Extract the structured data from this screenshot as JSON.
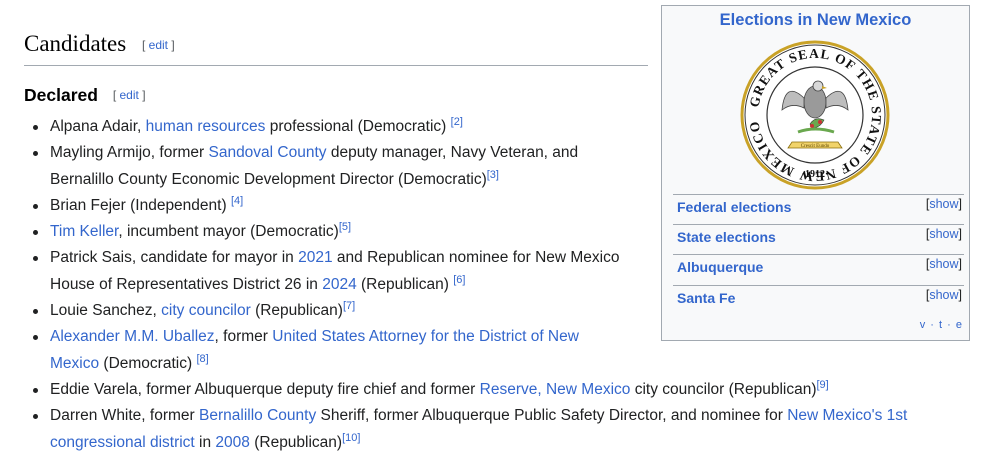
{
  "section": {
    "title": "Candidates",
    "edit_label": "edit",
    "bracket_open": "[",
    "bracket_close": "]"
  },
  "subsection": {
    "title": "Declared",
    "edit_label": "edit"
  },
  "candidates": [
    {
      "parts": [
        {
          "t": "Alpana Adair, "
        },
        {
          "t": "human resources",
          "link": true
        },
        {
          "t": " professional (Democratic) "
        }
      ],
      "ref": "[2]"
    },
    {
      "parts": [
        {
          "t": "Mayling Armijo, former "
        },
        {
          "t": "Sandoval County",
          "link": true
        },
        {
          "t": " deputy manager, Navy Veteran, and Bernalillo County Economic Development Director (Democratic)"
        }
      ],
      "ref": "[3]"
    },
    {
      "parts": [
        {
          "t": "Brian Fejer (Independent) "
        }
      ],
      "ref": "[4]"
    },
    {
      "parts": [
        {
          "t": "Tim Keller",
          "link": true
        },
        {
          "t": ", incumbent mayor (Democratic)"
        }
      ],
      "ref": "[5]"
    },
    {
      "parts": [
        {
          "t": "Patrick Sais, candidate for mayor in "
        },
        {
          "t": "2021",
          "link": true
        },
        {
          "t": " and Republican nominee for New Mexico House of Representatives District 26 in "
        },
        {
          "t": "2024",
          "link": true
        },
        {
          "t": " (Republican) "
        }
      ],
      "ref": "[6]"
    },
    {
      "parts": [
        {
          "t": "Louie Sanchez, "
        },
        {
          "t": "city councilor",
          "link": true
        },
        {
          "t": " (Republican)"
        }
      ],
      "ref": "[7]"
    },
    {
      "parts": [
        {
          "t": "Alexander M.M. Uballez",
          "link": true
        },
        {
          "t": ", former "
        },
        {
          "t": "United States Attorney for the District of New Mexico",
          "link": true
        },
        {
          "t": " (Democratic) "
        }
      ],
      "ref": "[8]"
    },
    {
      "parts": [
        {
          "t": "Eddie Varela, former Albuquerque deputy fire chief and former "
        },
        {
          "t": "Reserve, New Mexico",
          "link": true
        },
        {
          "t": " city councilor (Republican)"
        }
      ],
      "ref": "[9]"
    },
    {
      "parts": [
        {
          "t": "Darren White, former "
        },
        {
          "t": "Bernalillo County",
          "link": true
        },
        {
          "t": " Sheriff, former Albuquerque Public Safety Director, and nominee for "
        },
        {
          "t": "New Mexico's 1st congressional district",
          "link": true
        },
        {
          "t": " in "
        },
        {
          "t": "2008",
          "link": true
        },
        {
          "t": " (Republican)"
        }
      ],
      "ref": "[10]"
    }
  ],
  "infobox": {
    "title": "Elections in New Mexico",
    "seal": {
      "ring_text": "GREAT SEAL OF THE STATE OF NEW MEXICO",
      "year": "·1912·",
      "banner": "Crescit Eundo"
    },
    "rows": [
      {
        "label": "Federal elections",
        "toggle": "show"
      },
      {
        "label": "State elections",
        "toggle": "show"
      },
      {
        "label": "Albuquerque",
        "toggle": "show"
      },
      {
        "label": "Santa Fe",
        "toggle": "show"
      }
    ],
    "navbox": {
      "v": "v",
      "t": "t",
      "e": "e",
      "sep": "·"
    }
  },
  "colors": {
    "link": "#3366cc",
    "text": "#202122",
    "border": "#a2a9b1",
    "infobox_bg": "#f8f9fa",
    "seal_gold": "#c9a227"
  }
}
